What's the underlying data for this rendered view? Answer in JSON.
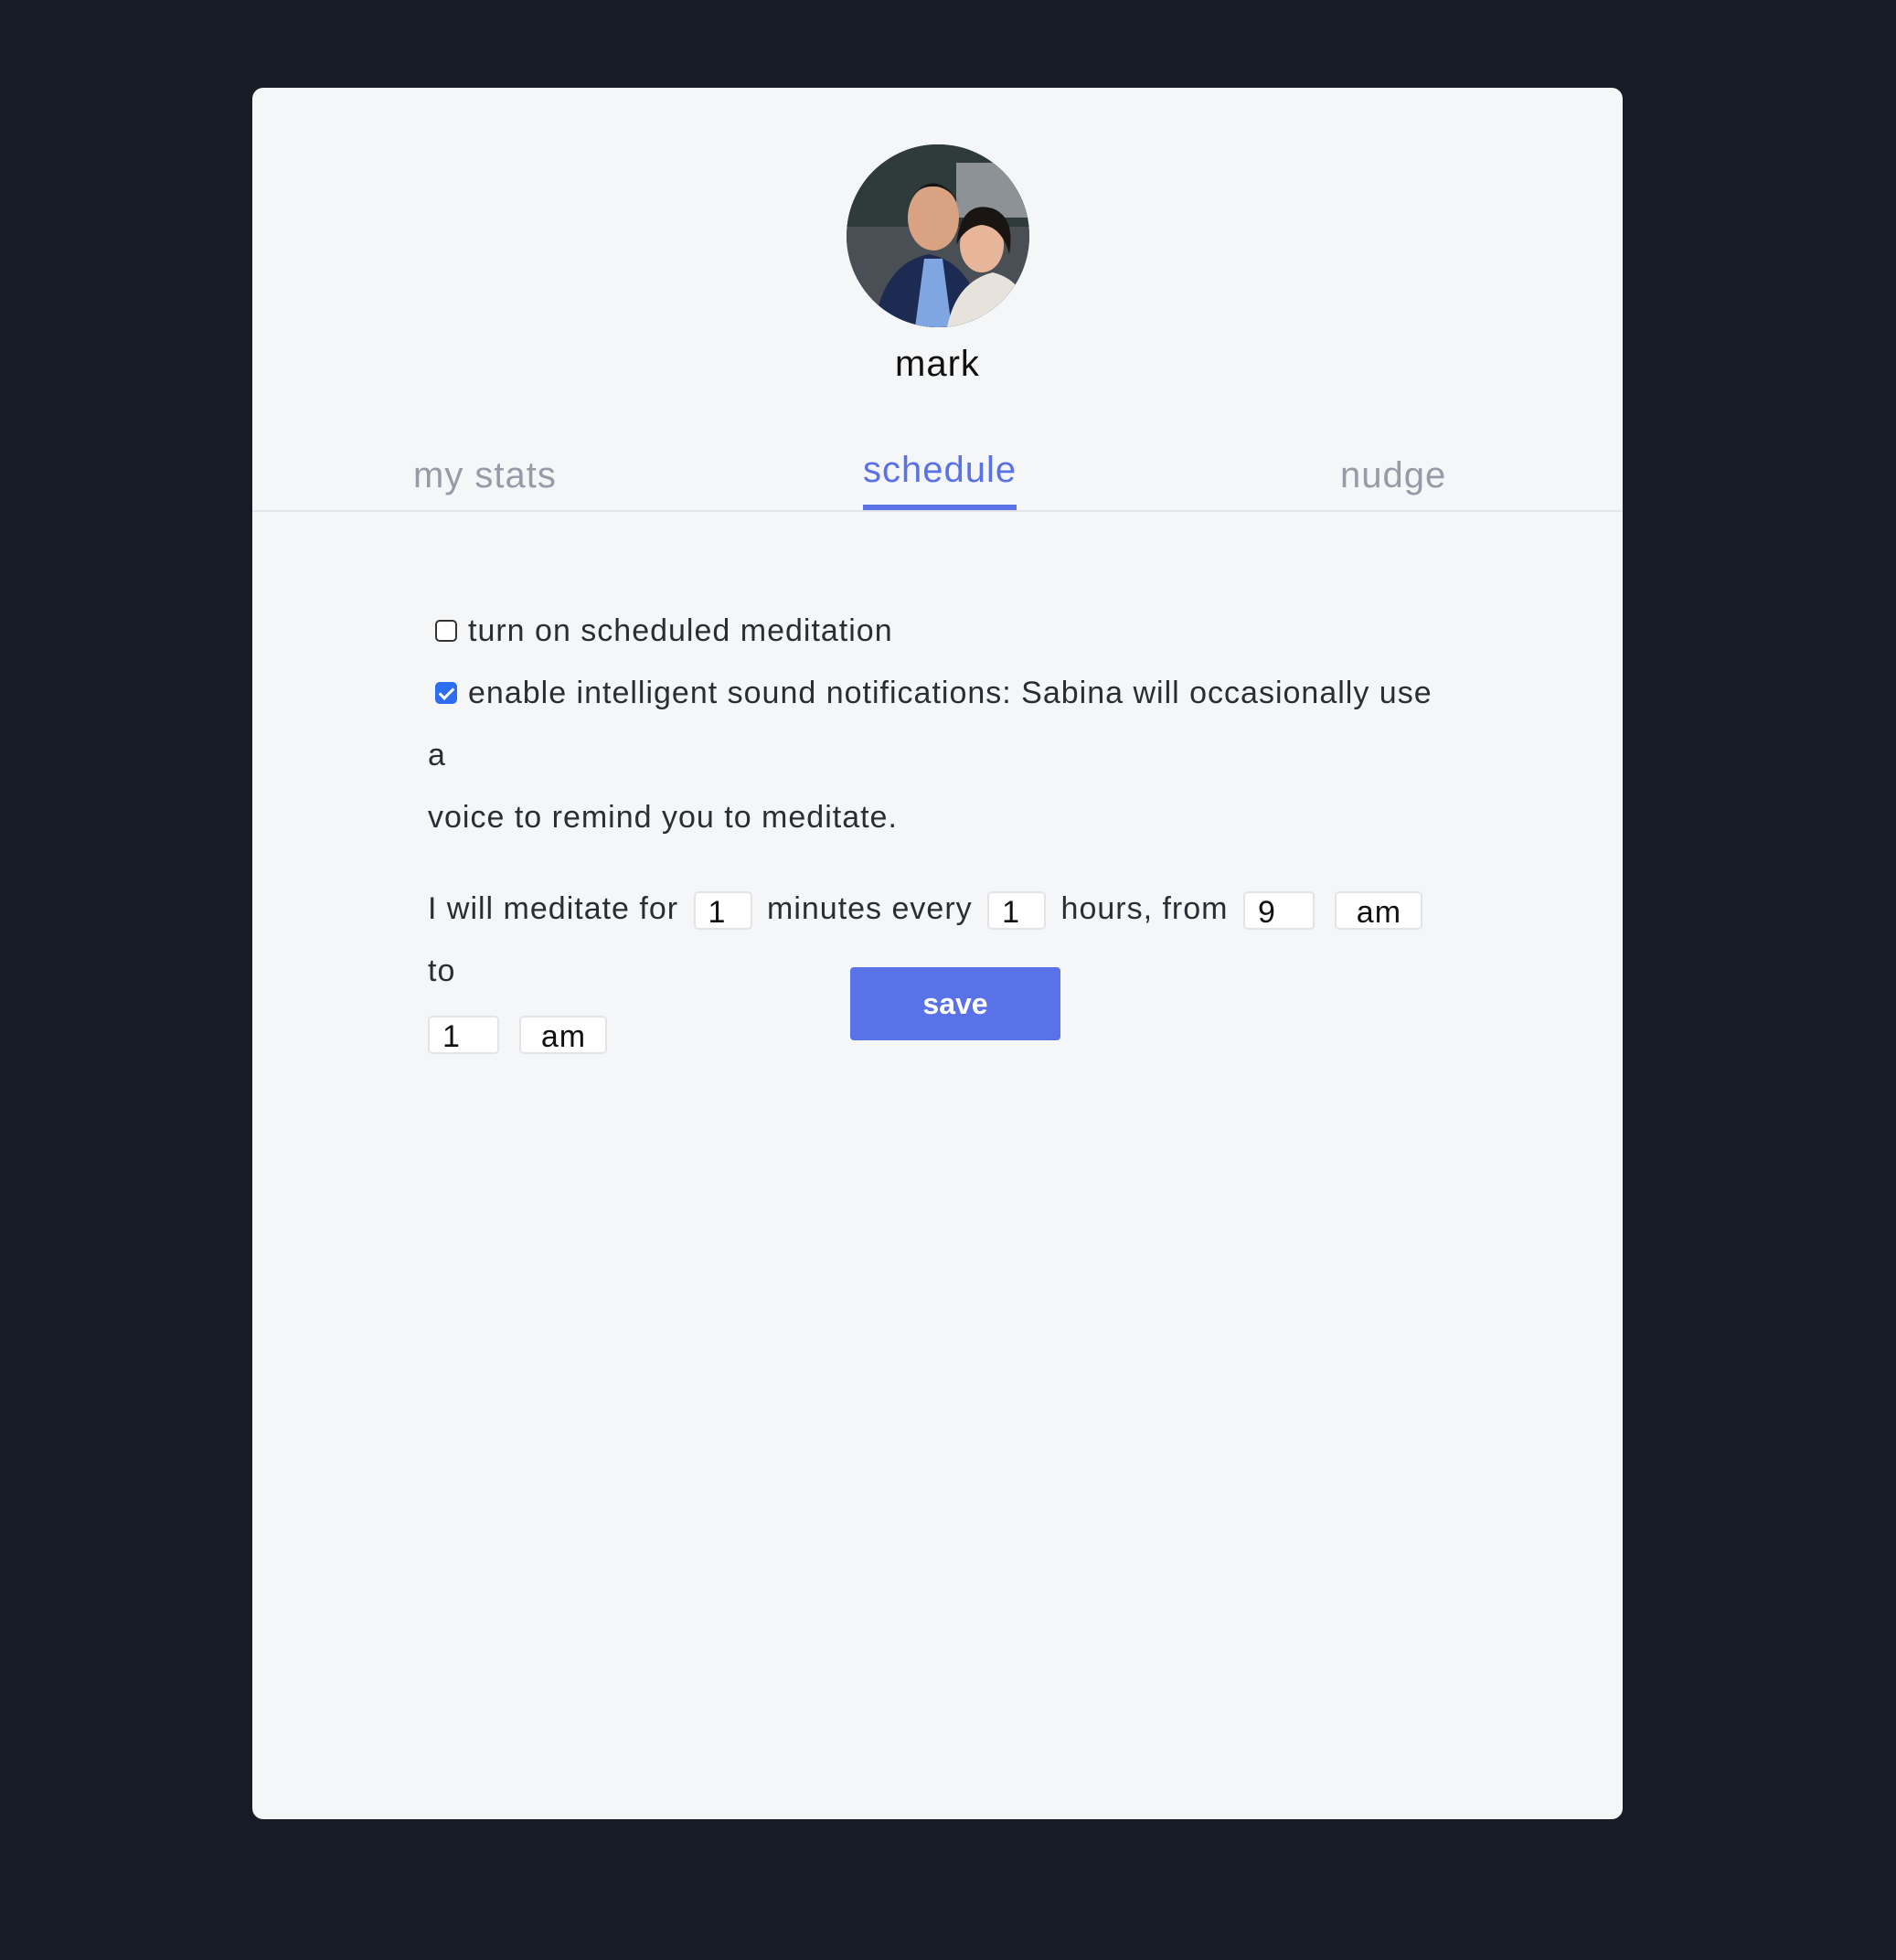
{
  "profile": {
    "username": "mark"
  },
  "tabs": [
    {
      "label": "my stats"
    },
    {
      "label": "schedule"
    },
    {
      "label": "nudge"
    }
  ],
  "colors": {
    "accent": "#5a72e8",
    "background": "#171b26",
    "card": "#f5f6f8"
  },
  "settings": {
    "scheduled_label": "turn on scheduled meditation",
    "scheduled_checked": false,
    "sound_label": "enable intelligent sound notifications: Sabina will occasionally use a",
    "sound_label_cont": "voice to remind you to meditate.",
    "sound_checked": true
  },
  "schedule": {
    "text_1": "I will meditate for",
    "minutes": "1",
    "text_2": "minutes every",
    "hours": "1",
    "text_3": "hours, from",
    "from_hour": "9",
    "from_ampm": "am",
    "text_4": "to",
    "to_hour": "1",
    "to_ampm": "am"
  },
  "save_label": "save"
}
